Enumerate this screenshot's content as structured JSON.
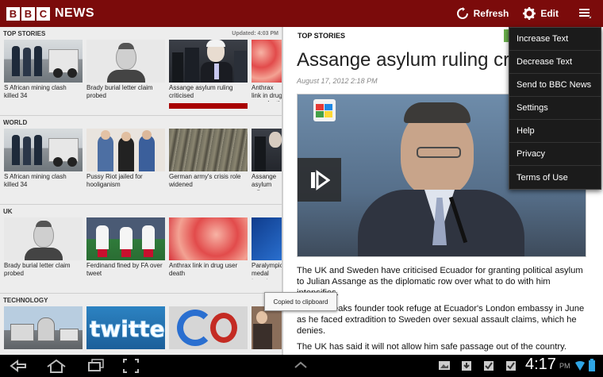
{
  "header": {
    "logo_letters": [
      "B",
      "B",
      "C"
    ],
    "logo_word": "NEWS",
    "refresh_label": "Refresh",
    "edit_label": "Edit",
    "icons": {
      "refresh": "refresh-icon",
      "edit": "gear-icon",
      "menu": "menu-icon"
    },
    "colors": {
      "bar": "#7b0b0b",
      "selected": "#a80000"
    }
  },
  "sections": [
    {
      "title": "TOP STORIES",
      "updated": "Updated: 4:03 PM",
      "stories": [
        {
          "caption": "S African mining clash killed 34",
          "image": "police-line"
        },
        {
          "caption": "Brady burial letter claim probed",
          "image": "portrait"
        },
        {
          "caption": "Assange asylum ruling criticised",
          "image": "assange",
          "selected": true
        },
        {
          "caption": "Anthrax link in drug user death",
          "image": "microscope"
        }
      ]
    },
    {
      "title": "WORLD",
      "updated": "",
      "stories": [
        {
          "caption": "S African mining clash killed 34",
          "image": "police-line"
        },
        {
          "caption": "Pussy Riot jailed for hooliganism",
          "image": "band"
        },
        {
          "caption": "German army's crisis role widened",
          "image": "soldiers"
        },
        {
          "caption": "Assange asylum ruling criticised",
          "image": "assange"
        }
      ]
    },
    {
      "title": "UK",
      "updated": "",
      "stories": [
        {
          "caption": "Brady burial letter claim probed",
          "image": "portrait"
        },
        {
          "caption": "Ferdinand fined by FA over tweet",
          "image": "footballers"
        },
        {
          "caption": "Anthrax link in drug user death",
          "image": "microscope"
        },
        {
          "caption": "Paralympic medal target",
          "image": "blue"
        }
      ]
    },
    {
      "title": "TECHNOLOGY",
      "updated": "",
      "stories": [
        {
          "caption": "",
          "image": "industrial"
        },
        {
          "caption": "",
          "image": "twitter"
        },
        {
          "caption": "",
          "image": "google"
        },
        {
          "caption": "",
          "image": "people"
        }
      ]
    }
  ],
  "article": {
    "section": "TOP STORIES",
    "headline": "Assange asylum ruling cr",
    "date": "August 17, 2012 2:18 PM",
    "paragraphs": [
      "The UK and Sweden have criticised Ecuador for granting political asylum to Julian Assange as the diplomatic row over what to do with him intensifies.",
      "The Wikileaks founder took refuge at Ecuador's London embassy in June as he faced extradition to Sweden over sexual assault claims, which he denies.",
      "The UK has said it will not allow him safe passage out of the country."
    ]
  },
  "menu": {
    "items": [
      "Increase Text",
      "Decrease Text",
      "Send to BBC News",
      "Settings",
      "Help",
      "Privacy",
      "Terms of Use"
    ]
  },
  "toast": {
    "text": "Copied to clipboard"
  },
  "system": {
    "time": "4:17",
    "ampm": "PM",
    "icons": [
      "back-icon",
      "home-icon",
      "recent-apps-icon",
      "screenshot-icon",
      "up-chevron-icon",
      "gallery-icon",
      "download-icon",
      "checkbox-icon",
      "checkbox-icon",
      "wifi-icon",
      "battery-icon"
    ]
  }
}
